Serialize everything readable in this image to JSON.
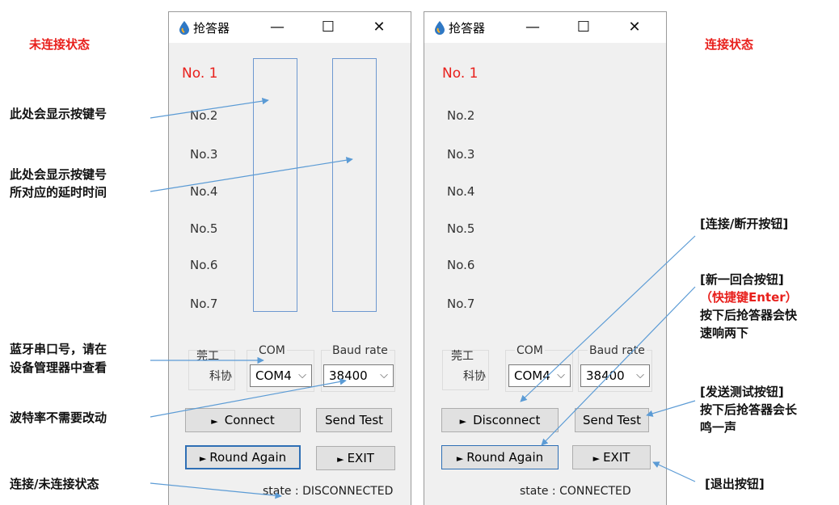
{
  "annotations": {
    "disconnected_heading": "未连接状态",
    "connected_heading": "连接状态",
    "key_number": "此处会显示按键号",
    "key_delay_line1": "此处会显示按键号",
    "key_delay_line2": "所对应的延时时间",
    "bt_port_line1": "蓝牙串口号，请在",
    "bt_port_line2": "设备管理器中查看",
    "baud_note": "波特率不需要改动",
    "state_note": "连接/未连接状态",
    "connect_button_note": "[连接/断开按钮]",
    "round_note_line1": "[新一回合按钮]",
    "round_note_line2": "（快捷键Enter）",
    "round_note_line3": "按下后抢答器会快",
    "round_note_line4": "速响两下",
    "send_note_line1": "[发送测试按钮]",
    "send_note_line2": "按下后抢答器会长",
    "send_note_line3": "鸣一声",
    "exit_note": "[退出按钮]"
  },
  "window_left": {
    "title": "抢答器",
    "slots": [
      "No. 1",
      "No.2",
      "No.3",
      "No.4",
      "No.5",
      "No.6",
      "No.7"
    ],
    "org_line1": "莞工",
    "org_line2": "科协",
    "com_label": "COM",
    "com_value": "COM4",
    "baud_label": "Baud rate",
    "baud_value": "38400",
    "connect_label": "Connect",
    "send_test_label": "Send Test",
    "round_again_label": "Round Again",
    "exit_label": "EXIT",
    "state_text": "state : DISCONNECTED"
  },
  "window_right": {
    "title": "抢答器",
    "slots": [
      "No. 1",
      "No.2",
      "No.3",
      "No.4",
      "No.5",
      "No.6",
      "No.7"
    ],
    "org_line1": "莞工",
    "org_line2": "科协",
    "com_label": "COM",
    "com_value": "COM4",
    "baud_label": "Baud rate",
    "baud_value": "38400",
    "connect_label": "Disconnect",
    "send_test_label": "Send Test",
    "round_again_label": "Round Again",
    "exit_label": "EXIT",
    "state_text": "state :   CONNECTED"
  },
  "icons": {
    "title_icon": "water-drop-icon",
    "minimize": "minimize-icon",
    "maximize": "maximize-icon",
    "close": "close-icon",
    "dropdown": "chevron-down-icon",
    "button_arrow": "play-triangle-icon"
  },
  "colors": {
    "annotation_red": "#e8201c",
    "arrow_blue": "#5b9bd5",
    "window_bg": "#f0f0f0",
    "focus_border": "#2f6fb5"
  }
}
